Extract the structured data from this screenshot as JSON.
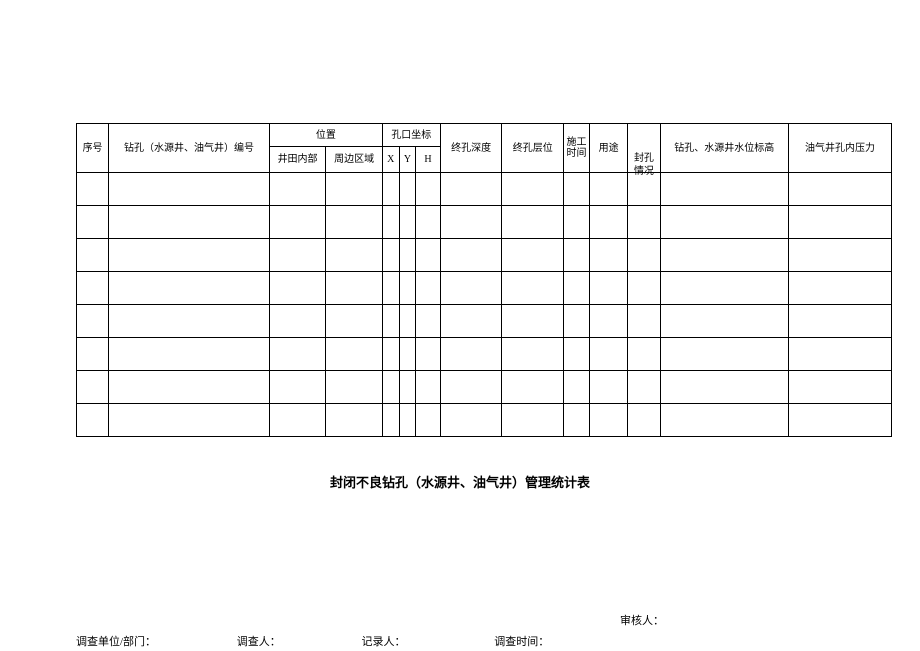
{
  "table": {
    "headers": {
      "seq": "序号",
      "drillNo": "钻孔（水源井、油气井）编号",
      "position": "位置",
      "positionInner": "井田内部",
      "positionOuter": "周边区域",
      "coord": "孔口坐标",
      "coordX": "X",
      "coordY": "Y",
      "coordH": "H",
      "depth": "终孔深度",
      "layer": "终孔层位",
      "time": "施工时间",
      "use": "用途",
      "seal": "封孔情况",
      "waterLevel": "钻孔、水源井水位标高",
      "pressure": "油气井孔内压力"
    }
  },
  "title": "封闭不良钻孔（水源井、油气井）管理统计表",
  "footer": {
    "unit": "调查单位/部门：",
    "investigator": "调查人：",
    "recorder": "记录人：",
    "investTime": "调查时间：",
    "reviewer": "审核人："
  }
}
